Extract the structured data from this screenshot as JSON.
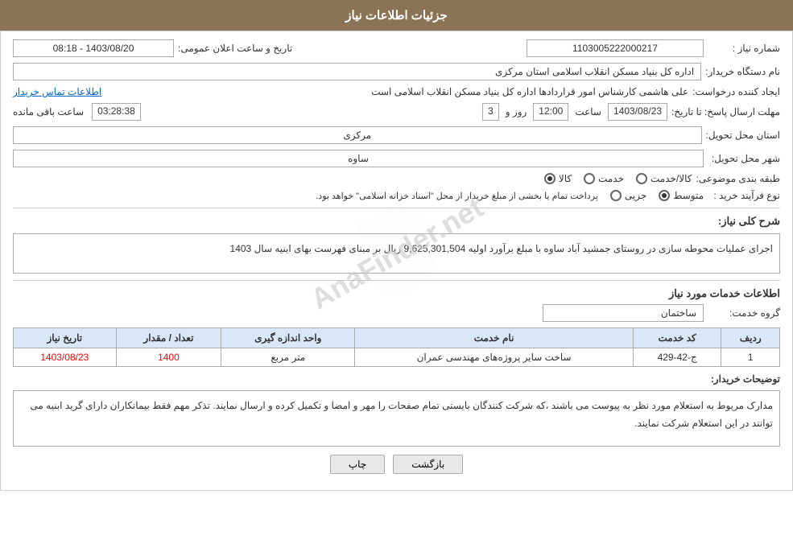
{
  "header": {
    "title": "جزئیات اطلاعات نیاز"
  },
  "fields": {
    "need_number_label": "شماره نیاز :",
    "need_number_value": "1103005222000217",
    "date_label": "تاریخ و ساعت اعلان عمومی:",
    "date_value": "1403/08/20 - 08:18",
    "buyer_label": "نام دستگاه خریدار:",
    "buyer_value": "اداره کل بنیاد مسکن انقلاب اسلامی استان مرکزی",
    "creator_label": "ایجاد کننده درخواست:",
    "creator_value": "علی هاشمی کارشناس امور قراردادها اداره کل بنیاد مسکن انقلاب اسلامی است",
    "contact_link": "اطلاعات تماس خریدار",
    "deadline_label": "مهلت ارسال پاسخ: تا تاریخ:",
    "deadline_date": "1403/08/23",
    "deadline_time_label": "ساعت",
    "deadline_time": "12:00",
    "deadline_days_label": "روز و",
    "deadline_days": "3",
    "deadline_remaining_label": "ساعت باقی مانده",
    "deadline_remaining": "03:28:38",
    "province_label": "استان محل تحویل:",
    "province_value": "مرکزی",
    "city_label": "شهر محل تحویل:",
    "city_value": "ساوه",
    "category_label": "طبقه بندی موضوعی:",
    "category_options": [
      "کالا",
      "خدمت",
      "کالا/خدمت"
    ],
    "category_selected": "کالا",
    "process_label": "نوع فرآیند خرید :",
    "process_options": [
      "جزیی",
      "متوسط"
    ],
    "process_selected": "متوسط",
    "process_note": "پرداخت تمام یا بخشی از مبلغ خریدار از محل \"اسناد خزانه اسلامی\" خواهد بود.",
    "description_label": "شرح کلی نیاز:",
    "description_value": "اجرای عملیات محوطه سازی در روستای جمشید آباد ساوه با مبلغ برآورد اولیه   9,625,301,504 ریال بر مبنای فهرست بهای ابنیه سال 1403",
    "services_title": "اطلاعات خدمات مورد نیاز",
    "service_group_label": "گروه خدمت:",
    "service_group_value": "ساختمان",
    "table": {
      "headers": [
        "ردیف",
        "کد خدمت",
        "نام خدمت",
        "واحد اندازه گیری",
        "تعداد / مقدار",
        "تاریخ نیاز"
      ],
      "rows": [
        {
          "row_num": "1",
          "code": "ج-42-429",
          "name": "ساخت سایر پروژه‌های مهندسی عمران",
          "unit": "متر مربع",
          "quantity": "1400",
          "date": "1403/08/23"
        }
      ]
    },
    "buyer_notes_label": "توضیحات خریدار:",
    "buyer_notes": "مدارک مربوط به استعلام مورد نظر به پیوست می باشند ،که شرکت کنندگان بایستی تمام صفحات را مهر و امضا و تکمیل کرده و ارسال نمایند. تذکر مهم فقط بیمانکاران دارای گرید ابنیه می توانند در این استعلام شرکت نمایند.",
    "buttons": {
      "back": "بازگشت",
      "print": "چاپ"
    }
  }
}
